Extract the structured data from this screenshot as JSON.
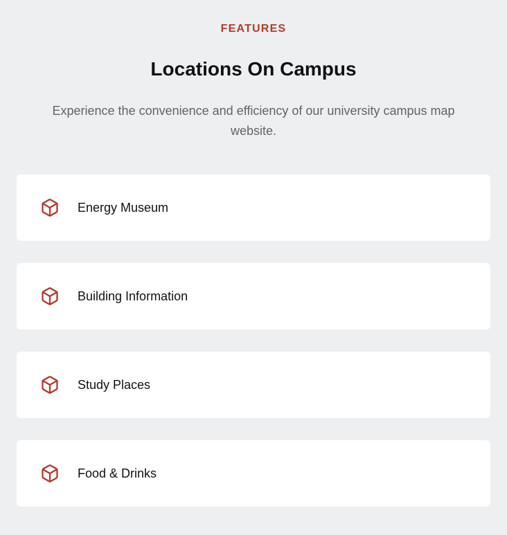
{
  "features": {
    "eyebrow": "FEATURES",
    "title": "Locations On Campus",
    "subtitle": "Experience the convenience and efficiency of our university campus map website.",
    "items": [
      {
        "label": "Energy Museum",
        "icon": "cube-icon"
      },
      {
        "label": "Building Information",
        "icon": "cube-icon"
      },
      {
        "label": "Study Places",
        "icon": "cube-icon"
      },
      {
        "label": "Food & Drinks",
        "icon": "cube-icon"
      }
    ]
  },
  "colors": {
    "background": "#eeeff1",
    "accent": "#b23b2b",
    "card": "#ffffff",
    "title": "#111111",
    "subtitle": "#60646a"
  }
}
